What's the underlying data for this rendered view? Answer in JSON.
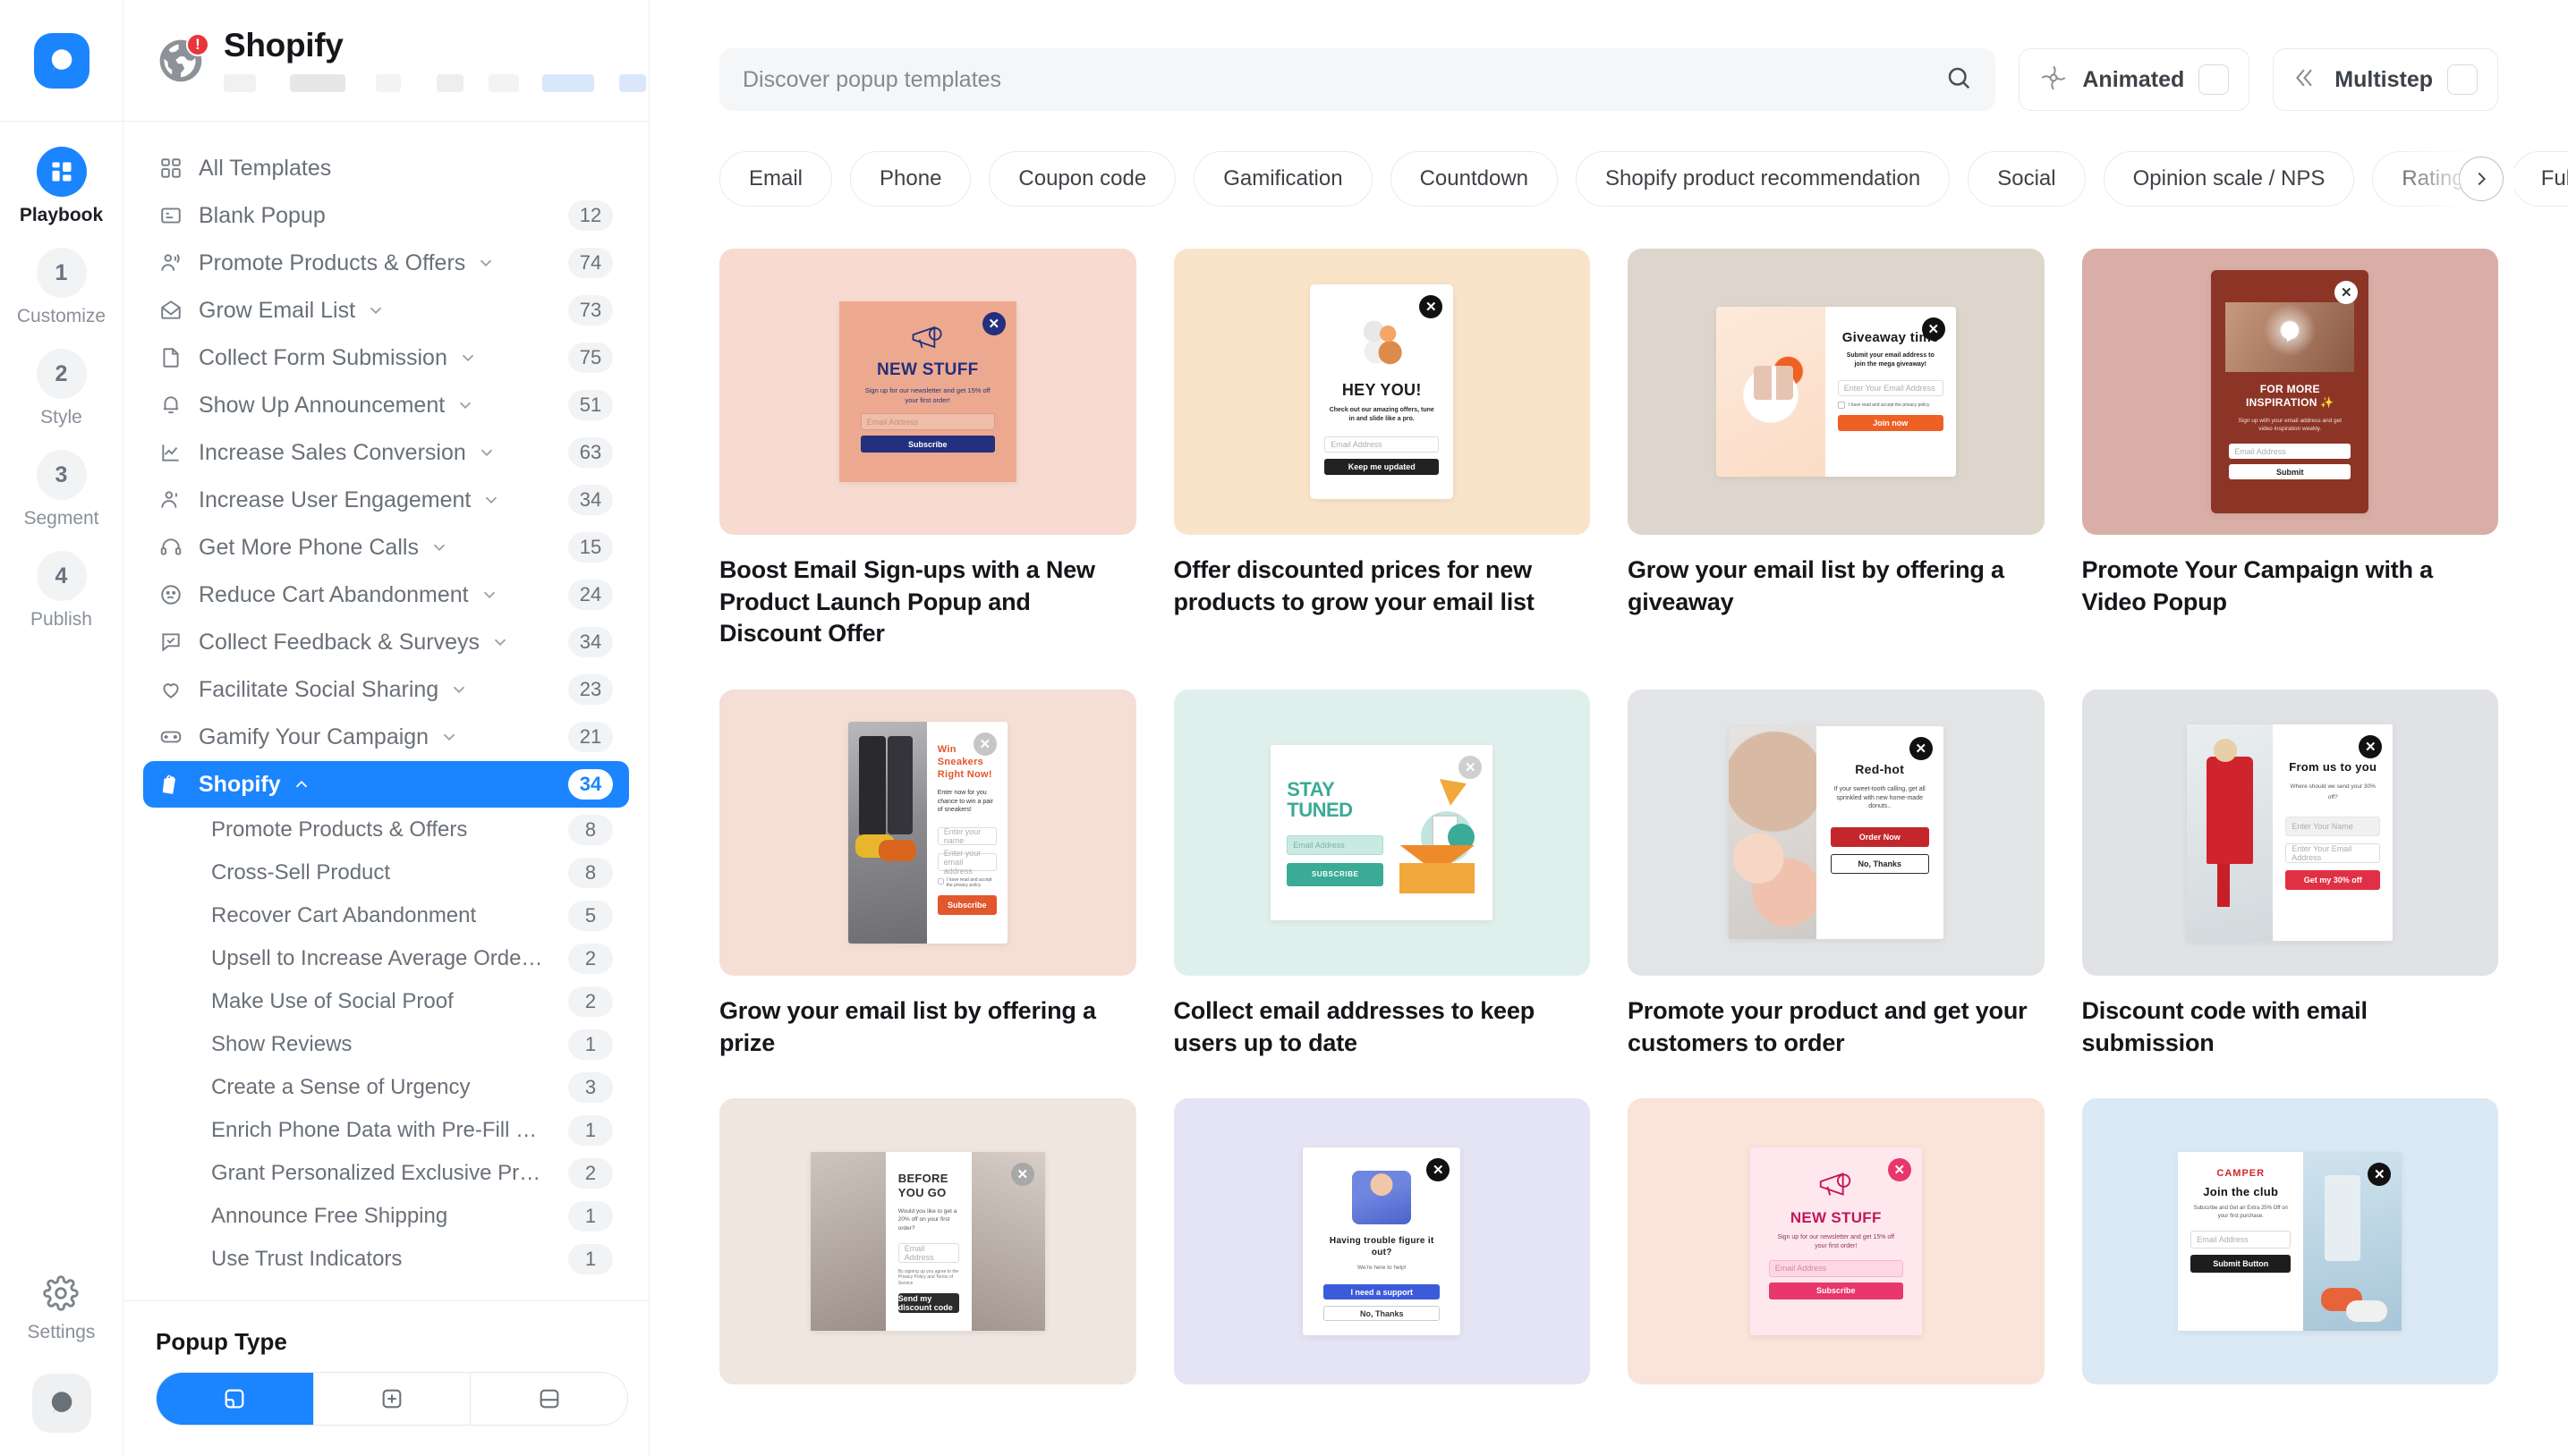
{
  "rail": {
    "logo_icon": "popupsmart-logo-icon",
    "steps": [
      {
        "badge": "",
        "label": "Playbook",
        "icon": "grid-icon",
        "active": true
      },
      {
        "badge": "1",
        "label": "Customize",
        "icon": "",
        "active": false
      },
      {
        "badge": "2",
        "label": "Style",
        "icon": "",
        "active": false
      },
      {
        "badge": "3",
        "label": "Segment",
        "icon": "",
        "active": false
      },
      {
        "badge": "4",
        "label": "Publish",
        "icon": "",
        "active": false
      }
    ],
    "settings_label": "Settings",
    "settings_icon": "gear-icon",
    "chat_icon": "chat-bubble-icon"
  },
  "category_panel": {
    "header": {
      "title": "Shopify",
      "icon": "globe-icon",
      "badge": "!"
    },
    "items": [
      {
        "label": "All Templates",
        "count": "",
        "icon": "grid-icon",
        "caret": false,
        "active": false
      },
      {
        "label": "Blank Popup",
        "count": "12",
        "icon": "blank-popup-icon",
        "caret": false,
        "active": false
      },
      {
        "label": "Promote Products & Offers",
        "count": "74",
        "icon": "megaphone-person-icon",
        "caret": true,
        "active": false
      },
      {
        "label": "Grow Email List",
        "count": "73",
        "icon": "open-envelope-icon",
        "caret": true,
        "active": false
      },
      {
        "label": "Collect Form Submission",
        "count": "75",
        "icon": "document-icon",
        "caret": true,
        "active": false
      },
      {
        "label": "Show Up Announcement",
        "count": "51",
        "icon": "bell-icon",
        "caret": true,
        "active": false
      },
      {
        "label": "Increase Sales Conversion",
        "count": "63",
        "icon": "chart-line-icon",
        "caret": true,
        "active": false
      },
      {
        "label": "Increase User Engagement",
        "count": "34",
        "icon": "users-icon",
        "caret": true,
        "active": false
      },
      {
        "label": "Get More Phone Calls",
        "count": "15",
        "icon": "headset-icon",
        "caret": true,
        "active": false
      },
      {
        "label": "Reduce Cart Abandonment",
        "count": "24",
        "icon": "sad-face-icon",
        "caret": true,
        "active": false
      },
      {
        "label": "Collect Feedback & Surveys",
        "count": "34",
        "icon": "chat-check-icon",
        "caret": true,
        "active": false
      },
      {
        "label": "Facilitate Social Sharing",
        "count": "23",
        "icon": "heart-icon",
        "caret": true,
        "active": false
      },
      {
        "label": "Gamify Your Campaign",
        "count": "21",
        "icon": "gamepad-icon",
        "caret": true,
        "active": false
      },
      {
        "label": "Shopify",
        "count": "34",
        "icon": "shopify-bag-icon",
        "caret": true,
        "active": true
      }
    ],
    "subitems": [
      {
        "label": "Promote Products & Offers",
        "count": "8"
      },
      {
        "label": "Cross-Sell Product",
        "count": "8"
      },
      {
        "label": "Recover Cart Abandonment",
        "count": "5"
      },
      {
        "label": "Upsell to Increase Average Orde…",
        "count": "2"
      },
      {
        "label": "Make Use of Social Proof",
        "count": "2"
      },
      {
        "label": "Show Reviews",
        "count": "1"
      },
      {
        "label": "Create a Sense of Urgency",
        "count": "3"
      },
      {
        "label": "Enrich Phone Data with Pre-Fill …",
        "count": "1"
      },
      {
        "label": "Grant Personalized Exclusive Pr…",
        "count": "2"
      },
      {
        "label": "Announce Free Shipping",
        "count": "1"
      },
      {
        "label": "Use Trust Indicators",
        "count": "1"
      }
    ],
    "popup_type": {
      "title": "Popup Type",
      "options": [
        {
          "icon": "popup-corner-icon",
          "active": true
        },
        {
          "icon": "popup-center-icon",
          "active": false
        },
        {
          "icon": "popup-bar-icon",
          "active": false
        }
      ]
    }
  },
  "main": {
    "search": {
      "placeholder": "Discover popup templates",
      "value": "",
      "icon": "search-icon"
    },
    "toggles": [
      {
        "label": "Animated",
        "icon": "animated-swirl-icon",
        "checked": false
      },
      {
        "label": "Multistep",
        "icon": "multistep-chevrons-icon",
        "checked": false
      }
    ],
    "chips": [
      "Email",
      "Phone",
      "Coupon code",
      "Gamification",
      "Countdown",
      "Shopify product recommendation",
      "Social",
      "Opinion scale / NPS",
      "Rating",
      "Full name"
    ],
    "chips_next_icon": "chevron-right-icon",
    "cards": [
      {
        "title": "Boost Email Sign-ups with a New Product Launch Popup and Discount Offer",
        "bg": "#f7dbd0",
        "popup": {
          "style": "center-peach",
          "panel_bg": "#eda98f",
          "accent": "#22307d",
          "heading": "NEW STUFF",
          "body": "Sign up for our newsletter and get 15% off your first order!",
          "input_placeholder": "Email Address",
          "button": "Subscribe",
          "close_bg": "#22307d"
        }
      },
      {
        "title": "Offer discounted prices for new products to grow your email list",
        "bg": "#fae4c9",
        "popup": {
          "style": "center-white",
          "panel_bg": "#ffffff",
          "accent": "#222222",
          "heading": "HEY YOU!",
          "body": "Check out our amazing offers, tune in and slide like a pro.",
          "input_placeholder": "Email Address",
          "button": "Keep me updated",
          "close_bg": "#111111"
        }
      },
      {
        "title": "Grow your email list by offering a giveaway",
        "bg": "#ded6cc",
        "popup": {
          "style": "split-gift",
          "panel_bg": "#ffffff",
          "accent": "#ef6025",
          "heading": "Giveaway time",
          "body": "Submit your email address to join the mega giveaway!",
          "input_placeholder": "Enter Your Email Address",
          "consent": "I have read and accept the privacy policy",
          "button": "Join now",
          "close_bg": "#111111"
        }
      },
      {
        "title": "Promote Your Campaign with a Video Popup",
        "bg": "#d9aea6",
        "popup": {
          "style": "video-maroon",
          "panel_bg": "#8c3527",
          "accent": "#ffffff",
          "heading": "FOR MORE INSPIRATION ✨",
          "body": "Sign up with your email address and get video inspiration weekly.",
          "input_placeholder": "Email Address",
          "button": "Submit",
          "close_bg": "#ffffff"
        }
      },
      {
        "title": "Grow your email list by offering a prize",
        "bg": "#f5ded6",
        "popup": {
          "style": "split-sneakers",
          "panel_bg": "#ffffff",
          "accent": "#e2572c",
          "heading": "Win Sneakers Right Now!",
          "body": "Enter now for you chance to win a pair of sneakers!",
          "input_placeholder": "Enter your name",
          "input2_placeholder": "Enter your email address",
          "consent": "I have read and accept the privacy policy",
          "button": "Subscribe",
          "close_bg": "#b9b9b9"
        }
      },
      {
        "title": "Collect email addresses to keep users up to date",
        "bg": "#dff0ec",
        "popup": {
          "style": "stay-tuned",
          "panel_bg": "#ffffff",
          "accent": "#3aab96",
          "heading": "STAY TUNED",
          "input_placeholder": "Email Address",
          "button": "SUBSCRIBE",
          "close_bg": "#c8c8c8"
        }
      },
      {
        "title": "Promote your product and get your customers to order",
        "bg": "#e3e4e6",
        "popup": {
          "style": "split-donut",
          "panel_bg": "#ffffff",
          "accent": "#c3272b",
          "heading": "Red-hot",
          "body": "If your sweet-tooth calling, get all sprinkled with new home-made donuts..",
          "button": "Order Now",
          "button2": "No, Thanks",
          "close_bg": "#111111"
        }
      },
      {
        "title": "Discount code with email submission",
        "bg": "#e0e2e5",
        "popup": {
          "style": "split-tomato",
          "panel_bg": "#ffffff",
          "accent": "#e03045",
          "heading": "From us to you",
          "body": "Where should we send your 30% off?",
          "input_placeholder": "Enter Your Name",
          "input2_placeholder": "Enter Your Email Address",
          "button": "Get my 30% off",
          "close_bg": "#111111"
        }
      },
      {
        "title": "",
        "bg": "#efe6e0",
        "popup": {
          "style": "split-glasses",
          "panel_bg": "#ffffff",
          "accent": "#2f2f2f",
          "heading": "BEFORE YOU GO",
          "body": "Would you like to get a 20% off on your first order?",
          "input_placeholder": "Email Address",
          "consent": "By signing up you agree to the Privacy Policy and Terms of Service",
          "button": "Send my discount code",
          "close_bg": "#9a9a9a"
        }
      },
      {
        "title": "",
        "bg": "#e4e4f5",
        "popup": {
          "style": "trouble",
          "panel_bg": "#ffffff",
          "accent": "#3b5bdb",
          "heading": "Having trouble figure it out?",
          "body": "We're here to help!",
          "button": "I need a support",
          "button2": "No, Thanks",
          "close_bg": "#111111"
        }
      },
      {
        "title": "",
        "bg": "#fae3d8",
        "popup": {
          "style": "newstuff-pink",
          "panel_bg": "#ffe7ee",
          "accent": "#e8386b",
          "heading": "NEW STUFF",
          "body": "Sign up for our newsletter and get 15% off your first order!",
          "input_placeholder": "Email Address",
          "button": "Subscribe",
          "close_bg": "#e8386b"
        }
      },
      {
        "title": "",
        "bg": "#dbe9f5",
        "popup": {
          "style": "camper",
          "panel_bg": "#ffffff",
          "accent": "#111111",
          "heading": "CAMPER",
          "subheading": "Join the club",
          "body": "Subscribe and Get an Extra 25% Off on your first purchase.",
          "input_placeholder": "Email Address",
          "button": "Submit Button",
          "close_bg": "#111111"
        }
      }
    ]
  }
}
